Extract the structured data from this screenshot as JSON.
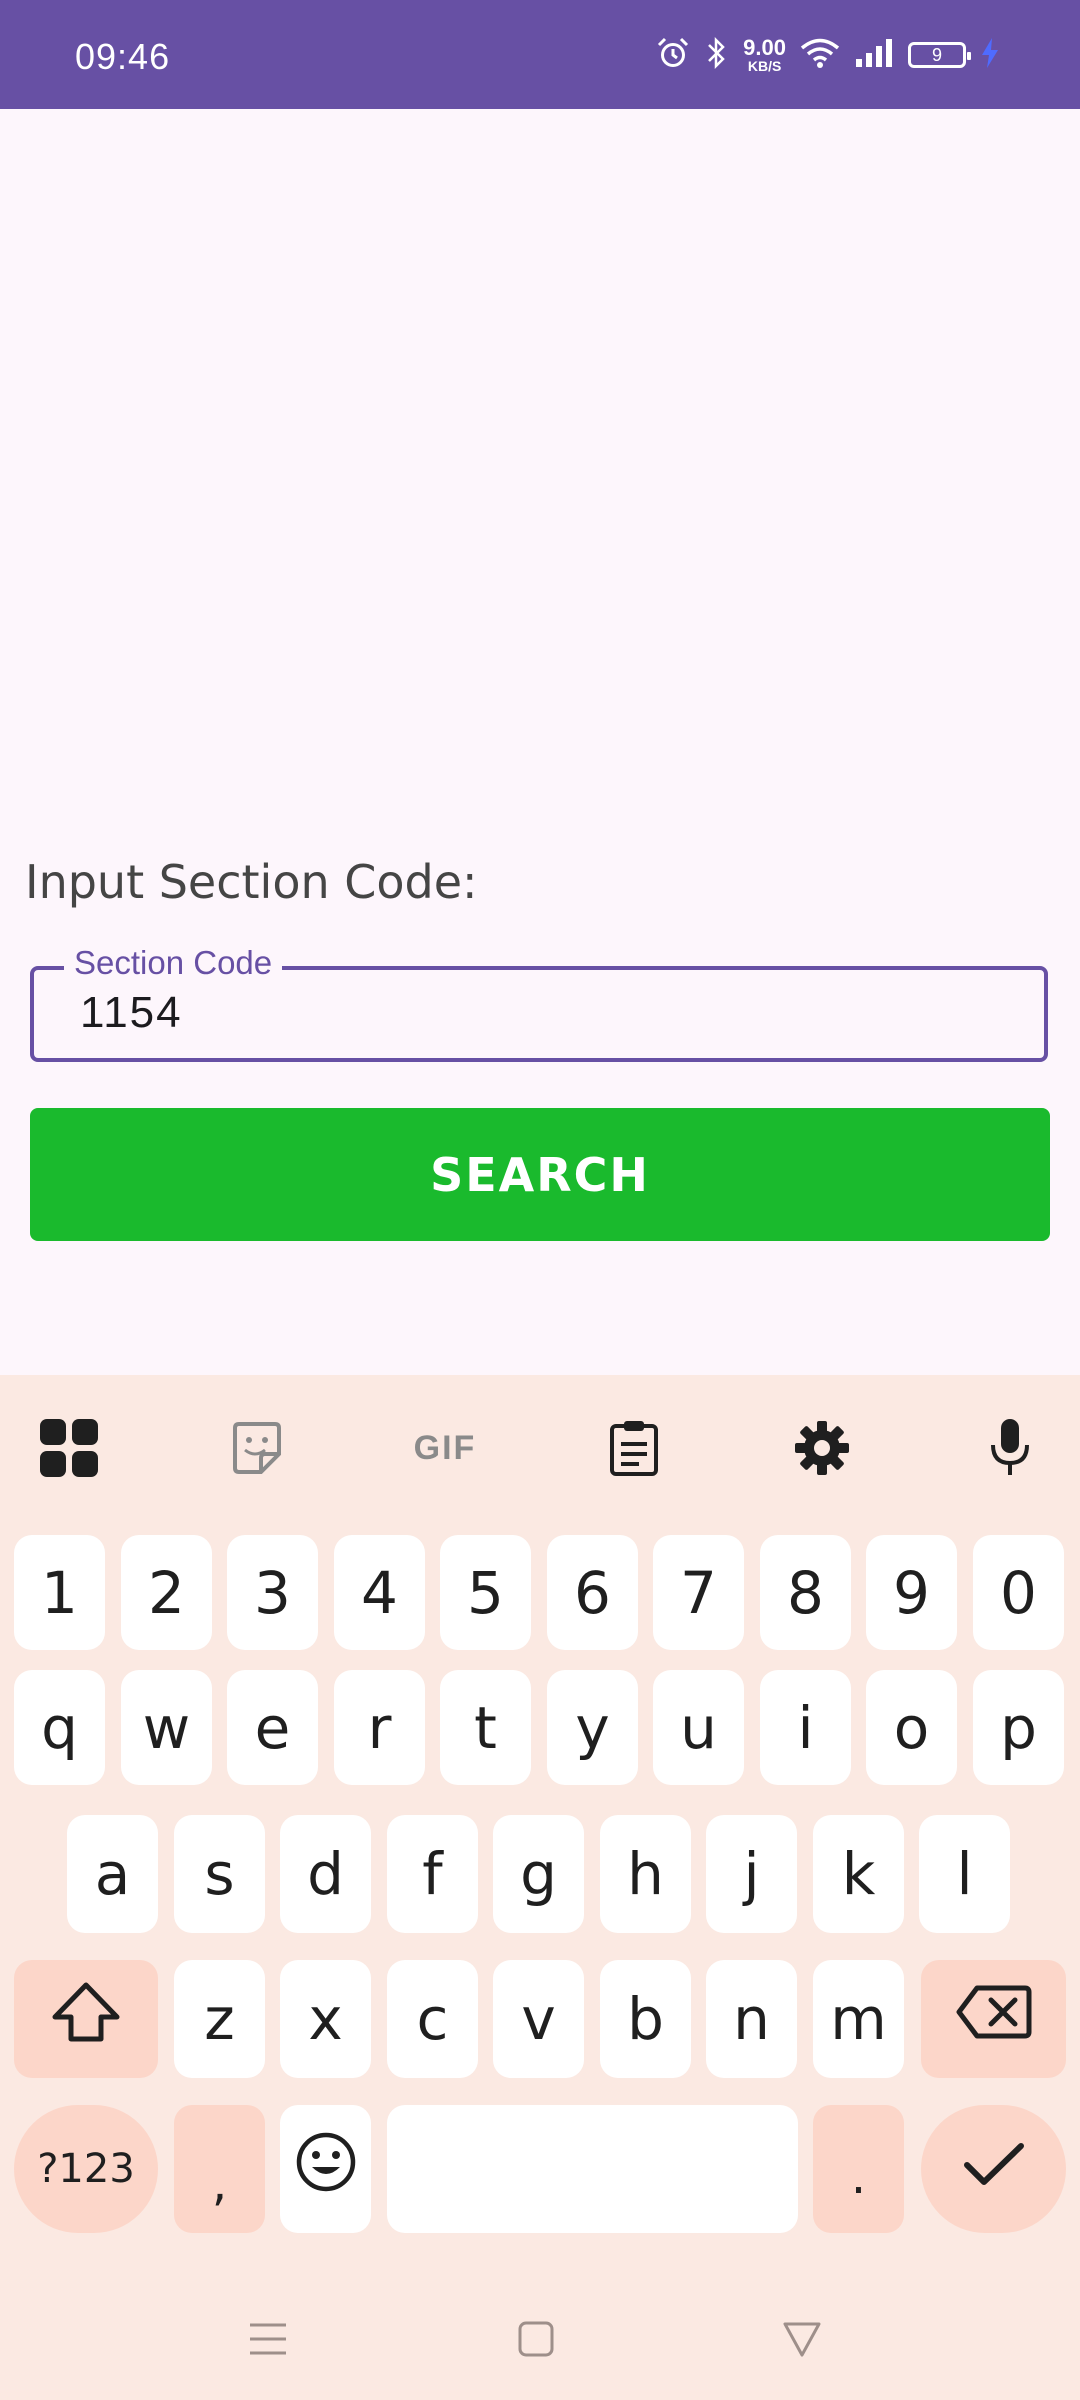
{
  "status_bar": {
    "time": "09:46",
    "network_speed_value": "9.00",
    "network_speed_unit": "KB/S",
    "battery_level": "9",
    "icons": [
      "alarm-icon",
      "bluetooth-icon",
      "wifi-icon",
      "signal-icon",
      "battery-icon",
      "charging-icon"
    ]
  },
  "main": {
    "prompt_label": "Input Section Code:",
    "field_label": "Section Code",
    "field_value": "1154",
    "search_button_label": "SEARCH"
  },
  "keyboard": {
    "toolbar_icons": [
      "apps-grid-icon",
      "sticker-icon",
      "gif-icon",
      "clipboard-icon",
      "settings-gear-icon",
      "microphone-icon"
    ],
    "gif_label": "GIF",
    "number_row": [
      "1",
      "2",
      "3",
      "4",
      "5",
      "6",
      "7",
      "8",
      "9",
      "0"
    ],
    "row_q": [
      "q",
      "w",
      "e",
      "r",
      "t",
      "y",
      "u",
      "i",
      "o",
      "p"
    ],
    "row_a": [
      "a",
      "s",
      "d",
      "f",
      "g",
      "h",
      "j",
      "k",
      "l"
    ],
    "row_z": [
      "z",
      "x",
      "c",
      "v",
      "b",
      "n",
      "m"
    ],
    "symbols_key": "?123",
    "comma_key": ",",
    "period_key": "."
  },
  "nav_bar": {
    "icons": [
      "recents-menu-icon",
      "home-square-icon",
      "back-triangle-icon"
    ]
  },
  "colors": {
    "status_bar": "#6750a4",
    "accent": "#6750a4",
    "search_button": "#1aba2d",
    "background": "#fdf6fc",
    "keyboard_background": "#fbe9e2",
    "special_key": "#fcd6c9"
  }
}
